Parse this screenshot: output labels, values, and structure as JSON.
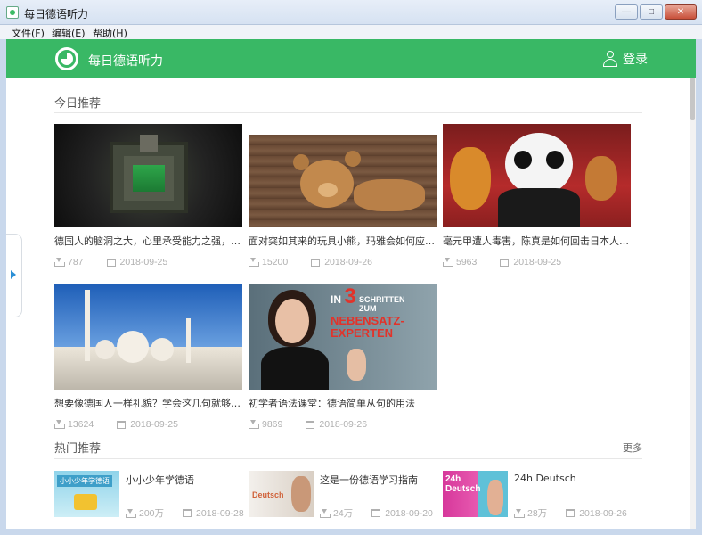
{
  "window": {
    "title": "每日德语听力",
    "controls": [
      "—",
      "□",
      "✕"
    ]
  },
  "menu": [
    {
      "label": "文件(F)"
    },
    {
      "label": "编辑(E)"
    },
    {
      "label": "帮助(H)"
    }
  ],
  "header": {
    "app_name": "每日德语听力",
    "login_label": "登录",
    "accent": "#39b865"
  },
  "today": {
    "title": "今日推荐",
    "cards": [
      {
        "title": "德国人的脑洞之大，心里承受能力之强，真...",
        "downloads": "787",
        "date": "2018-09-25"
      },
      {
        "title": "面对突如其来的玩具小熊，玛雅会如何应对...",
        "downloads": "15200",
        "date": "2018-09-26"
      },
      {
        "title": "毫元甲遭人毒害，陈真是如何回击日本人的？",
        "downloads": "5963",
        "date": "2018-09-25"
      },
      {
        "title": "想要像德国人一样礼貌？学会这几句就够了~",
        "downloads": "13624",
        "date": "2018-09-25"
      },
      {
        "title": "初学者语法课堂：德语简单从句的用法",
        "downloads": "9869",
        "date": "2018-09-26",
        "thumb_text": [
          "IN",
          "3",
          "SCHRITTEN",
          "ZUM",
          "NEBENSATZ-",
          "EXPERTEN"
        ]
      }
    ]
  },
  "hot": {
    "title": "热门推荐",
    "more_label": "更多",
    "items": [
      {
        "title": "小小少年学德语",
        "downloads": "200万",
        "date": "2018-09-28",
        "thumb_text": "小小少年学德语"
      },
      {
        "title": "这是一份德语学习指南",
        "downloads": "24万",
        "date": "2018-09-20",
        "thumb_text": "Deutsch"
      },
      {
        "title": "24h Deutsch",
        "downloads": "28万",
        "date": "2018-09-26",
        "thumb_text": [
          "24h",
          "Deutsch"
        ]
      }
    ]
  }
}
